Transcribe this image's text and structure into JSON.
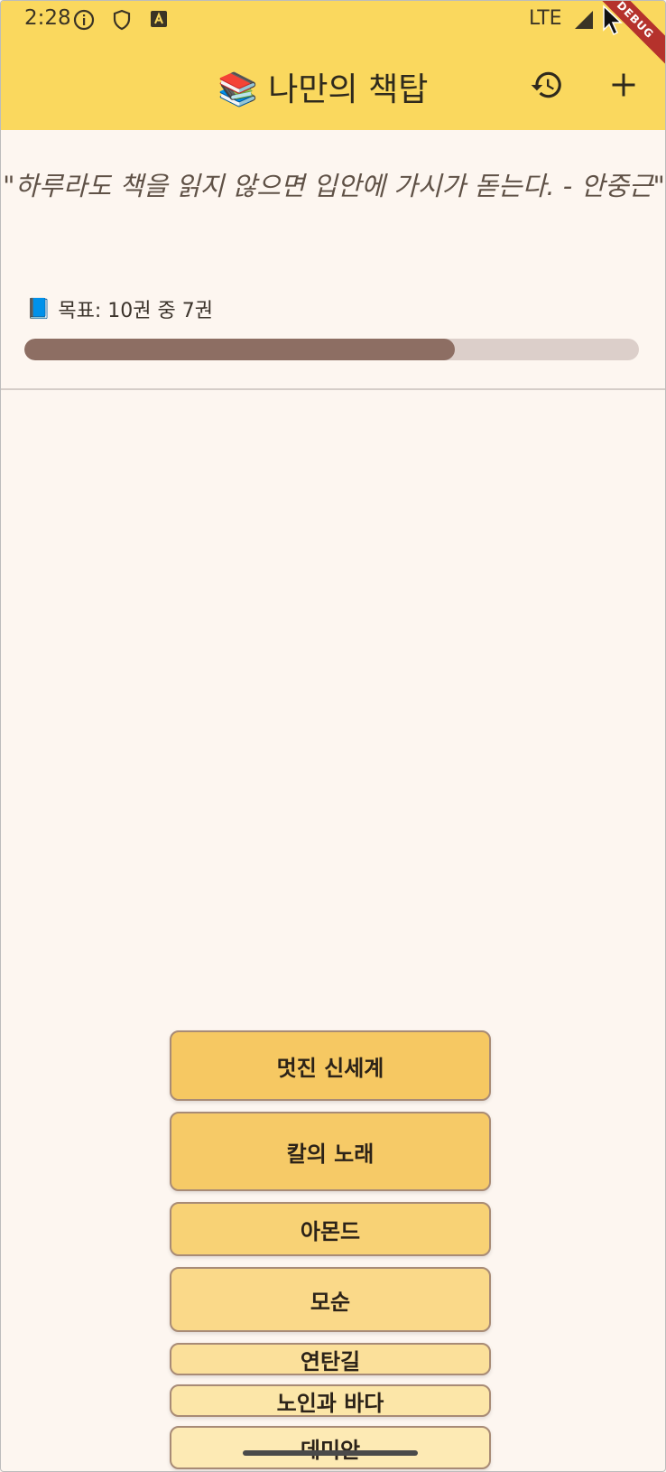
{
  "status_bar": {
    "time": "2:28",
    "network": "LTE",
    "icons": [
      "info-circle-icon",
      "shield-icon",
      "a-badge-icon",
      "signal-icon"
    ]
  },
  "debug_banner": "DEBUG",
  "app_bar": {
    "title": "📚 나만의 책탑",
    "actions": [
      "history-icon",
      "add-icon"
    ]
  },
  "quote": "\"하루라도 책을 읽지 않으면 입안에 가시가 돋는다. - 안중근\"",
  "goal": {
    "icon": "📘",
    "label": "목표: 10권 중 7권",
    "read": 7,
    "total": 10,
    "progress": 0.7
  },
  "books": [
    {
      "title": "멋진 신세계",
      "color": "#f6c862"
    },
    {
      "title": "칼의 노래",
      "color": "#f6ca67"
    },
    {
      "title": "아몬드",
      "color": "#f8d275"
    },
    {
      "title": "모순",
      "color": "#fad989"
    },
    {
      "title": "연탄길",
      "color": "#fbe09a"
    },
    {
      "title": "노인과 바다",
      "color": "#fce6a8"
    },
    {
      "title": "데미안",
      "color": "#fdeab4"
    }
  ],
  "colors": {
    "app_bar": "#fad85e",
    "background": "#fdf6f0",
    "progress_fill": "#8d6e63",
    "progress_track": "#dccfca"
  }
}
